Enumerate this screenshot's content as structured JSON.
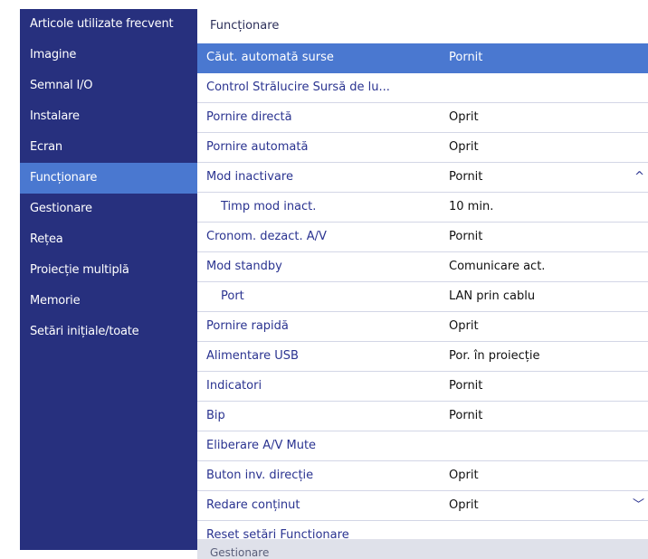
{
  "sidebar": {
    "items": [
      {
        "label": "Articole utilizate frecvent"
      },
      {
        "label": "Imagine"
      },
      {
        "label": "Semnal I/O"
      },
      {
        "label": "Instalare"
      },
      {
        "label": "Ecran"
      },
      {
        "label": "Funcționare"
      },
      {
        "label": "Gestionare"
      },
      {
        "label": "Rețea"
      },
      {
        "label": "Proiecție multiplă"
      },
      {
        "label": "Memorie"
      },
      {
        "label": "Setări inițiale/toate"
      }
    ]
  },
  "main": {
    "title": "Funcționare",
    "rows": [
      {
        "label": "Căut. automată surse",
        "value": "Pornit"
      },
      {
        "label": "Control Strălucire Sursă de lu...",
        "value": ""
      },
      {
        "label": "Pornire directă",
        "value": "Oprit"
      },
      {
        "label": "Pornire automată",
        "value": "Oprit"
      },
      {
        "label": "Mod inactivare",
        "value": "Pornit",
        "chevron": "^"
      },
      {
        "label": "Timp mod inact.",
        "value": "10 min."
      },
      {
        "label": "Cronom. dezact. A/V",
        "value": "Pornit"
      },
      {
        "label": "Mod standby",
        "value": "Comunicare act."
      },
      {
        "label": "Port",
        "value": "LAN prin cablu"
      },
      {
        "label": "Pornire rapidă",
        "value": "Oprit"
      },
      {
        "label": "Alimentare USB",
        "value": "Por. în proiecție"
      },
      {
        "label": "Indicatori",
        "value": "Pornit"
      },
      {
        "label": "Bip",
        "value": "Pornit"
      },
      {
        "label": "Eliberare A/V Mute",
        "value": ""
      },
      {
        "label": "Buton inv. direcție",
        "value": "Oprit"
      },
      {
        "label": "Redare conținut",
        "value": "Oprit",
        "chevron": "﹀"
      },
      {
        "label": "Reset setări Funcționare",
        "value": ""
      }
    ],
    "footer": "Gestionare"
  },
  "colors": {
    "sidebar_bg": "#27307e",
    "highlight": "#4a78d0",
    "label_text": "#2a3390"
  },
  "icons": [
    "chevron-up-icon",
    "chevron-down-icon"
  ]
}
